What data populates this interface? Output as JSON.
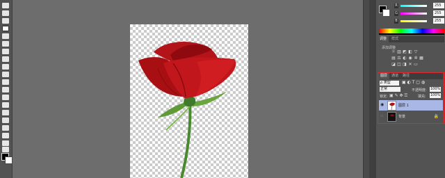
{
  "toolbar": {
    "tools": [
      "marquee-tool",
      "move-tool",
      "lasso-tool",
      "quick-selection-tool",
      "crop-tool",
      "eyedropper-tool",
      "healing-tool",
      "brush-tool",
      "clone-stamp-tool",
      "history-brush-tool",
      "eraser-tool",
      "gradient-tool",
      "blur-tool",
      "dodge-tool",
      "pen-tool",
      "type-tool",
      "path-selection-tool",
      "rectangle-tool",
      "hand-tool",
      "zoom-tool"
    ],
    "active_tool": "quick-selection-tool"
  },
  "canvas": {
    "subject": "rose-image"
  },
  "color_panel": {
    "r_value": "255",
    "g_value": "255",
    "b_value": "255",
    "foreground": "#000000",
    "background": "#ffffff"
  },
  "adjustments_panel": {
    "tabs": [
      "调整",
      "样式"
    ],
    "add_label": "添加调整",
    "icons": [
      "brightness-icon",
      "levels-icon",
      "curves-icon",
      "exposure-icon",
      "vibrance-icon",
      "hue-icon",
      "color-balance-icon",
      "bw-icon",
      "photo-filter-icon",
      "channel-mixer-icon",
      "lookup-icon",
      "invert-icon",
      "posterize-icon",
      "threshold-icon",
      "selective-color-icon",
      "gradient-map-icon"
    ]
  },
  "layers_panel": {
    "tabs": [
      "图层",
      "通道",
      "路径"
    ],
    "filter_kind": "ρ 类型",
    "blend_mode": "正常",
    "opacity_label": "不透明度:",
    "opacity_value": "100%",
    "lock_label": "锁定:",
    "fill_label": "填充:",
    "fill_value": "100%",
    "layers": [
      {
        "name": "图层 1",
        "selected": true,
        "visible": true
      },
      {
        "name": "背景",
        "selected": false,
        "visible": false,
        "locked": true
      }
    ]
  },
  "highlight_color": "#e2262a"
}
